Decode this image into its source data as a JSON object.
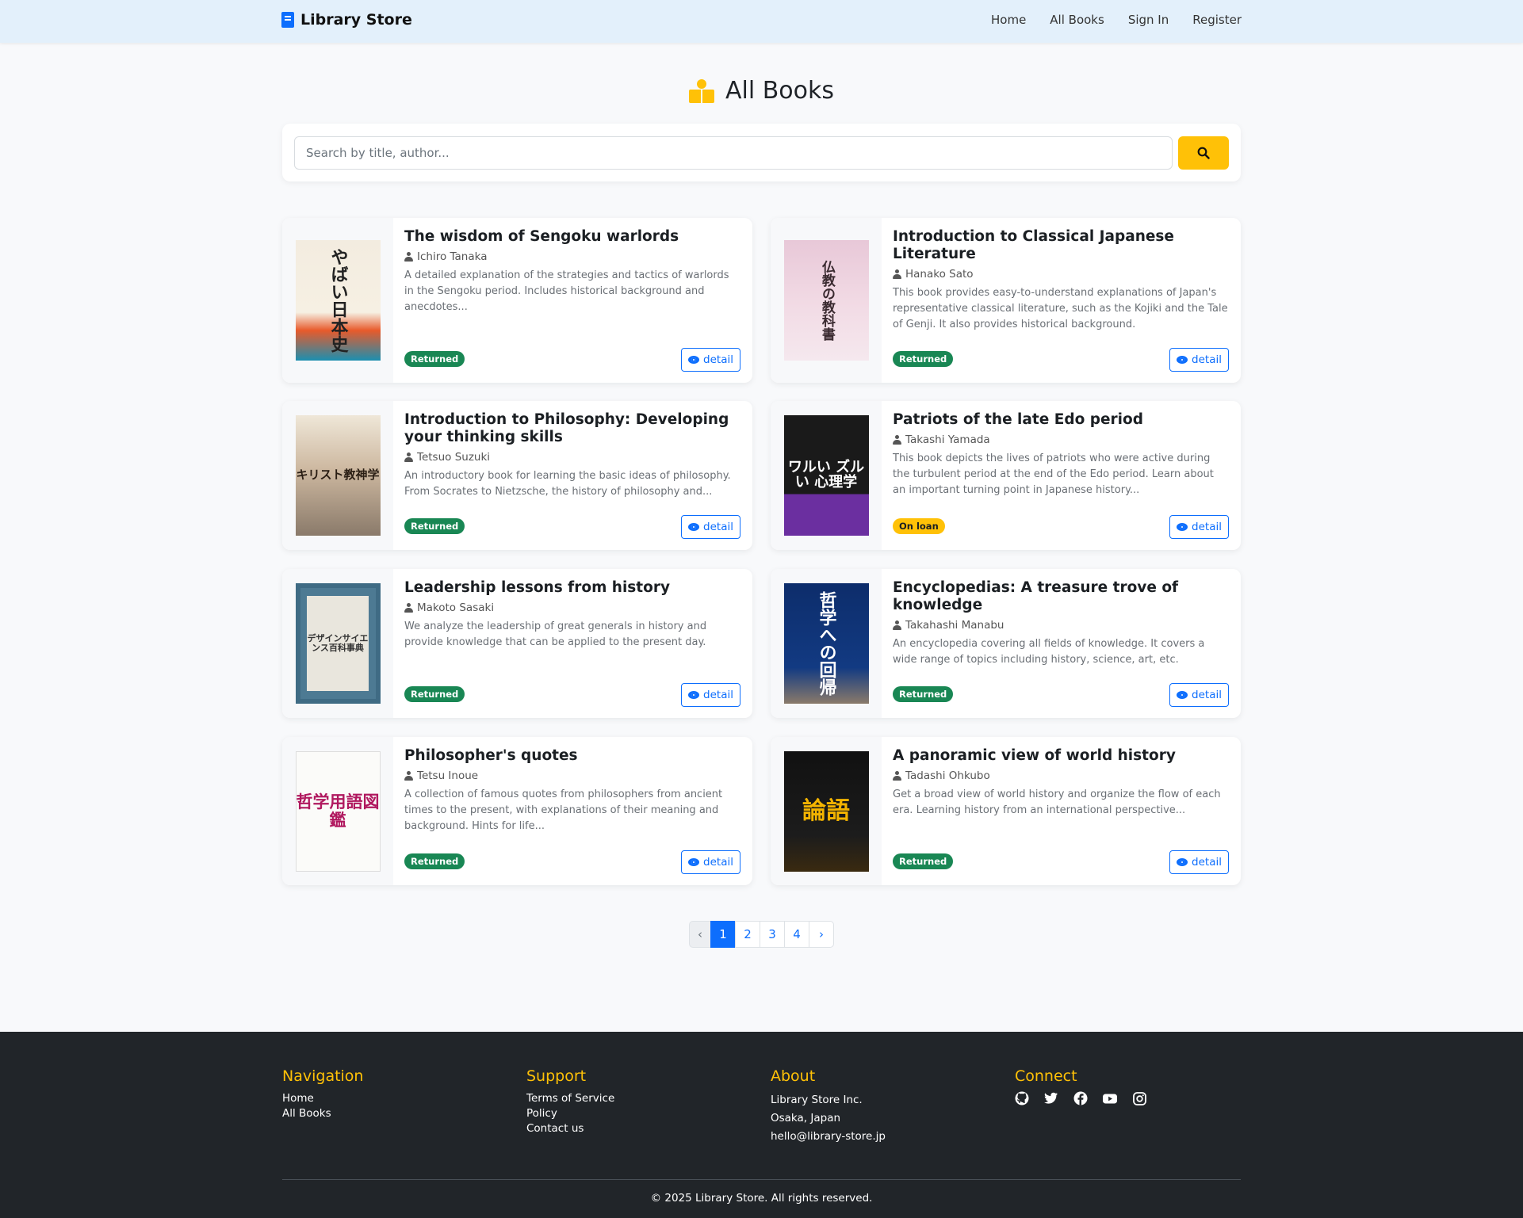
{
  "header": {
    "brand": "Library Store",
    "nav": [
      "Home",
      "All Books",
      "Sign In",
      "Register"
    ]
  },
  "page": {
    "title": "All Books"
  },
  "search": {
    "placeholder": "Search by title, author..."
  },
  "books": [
    {
      "title": "The wisdom of Sengoku warlords",
      "author": "Ichiro Tanaka",
      "description": "A detailed explanation of the strategies and tactics of warlords in the Sengoku period. Includes historical background and anecdotes...",
      "status": "Returned",
      "detail_label": "detail",
      "cover_text": "やばい日本史"
    },
    {
      "title": "Introduction to Classical Japanese Literature",
      "author": "Hanako Sato",
      "description": "This book provides easy-to-understand explanations of Japan's representative classical literature, such as the Kojiki and the Tale of Genji. It also provides historical background.",
      "status": "Returned",
      "detail_label": "detail",
      "cover_text": "仏教の教科書"
    },
    {
      "title": "Introduction to Philosophy: Developing your thinking skills",
      "author": "Tetsuo Suzuki",
      "description": "An introductory book for learning the basic ideas of philosophy. From Socrates to Nietzsche, the history of philosophy and...",
      "status": "Returned",
      "detail_label": "detail",
      "cover_text": "キリスト教神学"
    },
    {
      "title": "Patriots of the late Edo period",
      "author": "Takashi Yamada",
      "description": "This book depicts the lives of patriots who were active during the turbulent period at the end of the Edo period. Learn about an important turning point in Japanese history...",
      "status": "On loan",
      "detail_label": "detail",
      "cover_text": "ワルい ズルい 心理学"
    },
    {
      "title": "Leadership lessons from history",
      "author": "Makoto Sasaki",
      "description": "We analyze the leadership of great generals in history and provide knowledge that can be applied to the present day.",
      "status": "Returned",
      "detail_label": "detail",
      "cover_text": "デザインサイエンス百科事典"
    },
    {
      "title": "Encyclopedias: A treasure trove of knowledge",
      "author": "Takahashi Manabu",
      "description": "An encyclopedia covering all fields of knowledge. It covers a wide range of topics including history, science, art, etc.",
      "status": "Returned",
      "detail_label": "detail",
      "cover_text": "哲学への回帰"
    },
    {
      "title": "Philosopher's quotes",
      "author": "Tetsu Inoue",
      "description": "A collection of famous quotes from philosophers from ancient times to the present, with explanations of their meaning and background. Hints for life...",
      "status": "Returned",
      "detail_label": "detail",
      "cover_text": "哲学用語図鑑"
    },
    {
      "title": "A panoramic view of world history",
      "author": "Tadashi Ohkubo",
      "description": "Get a broad view of world history and organize the flow of each era. Learning history from an international perspective...",
      "status": "Returned",
      "detail_label": "detail",
      "cover_text": "論語"
    }
  ],
  "pagination": {
    "prev": "‹",
    "pages": [
      "1",
      "2",
      "3",
      "4"
    ],
    "next": "›",
    "active_page": 1
  },
  "footer": {
    "navigation": {
      "heading": "Navigation",
      "links": [
        "Home",
        "All Books"
      ]
    },
    "support": {
      "heading": "Support",
      "links": [
        "Terms of Service",
        "Policy",
        "Contact us"
      ]
    },
    "about": {
      "heading": "About",
      "lines": [
        "Library Store Inc.",
        "Osaka, Japan",
        "hello@library-store.jp"
      ]
    },
    "connect": {
      "heading": "Connect",
      "icons": [
        "github-icon",
        "twitter-icon",
        "facebook-icon",
        "youtube-icon",
        "instagram-icon"
      ]
    },
    "copyright": "© 2025 Library Store. All rights reserved."
  },
  "colors": {
    "accent": "#ffc107",
    "primary": "#0d6efd",
    "returned": "#198754",
    "footer_bg": "#212529",
    "navbar_bg": "#e3f0fb"
  }
}
